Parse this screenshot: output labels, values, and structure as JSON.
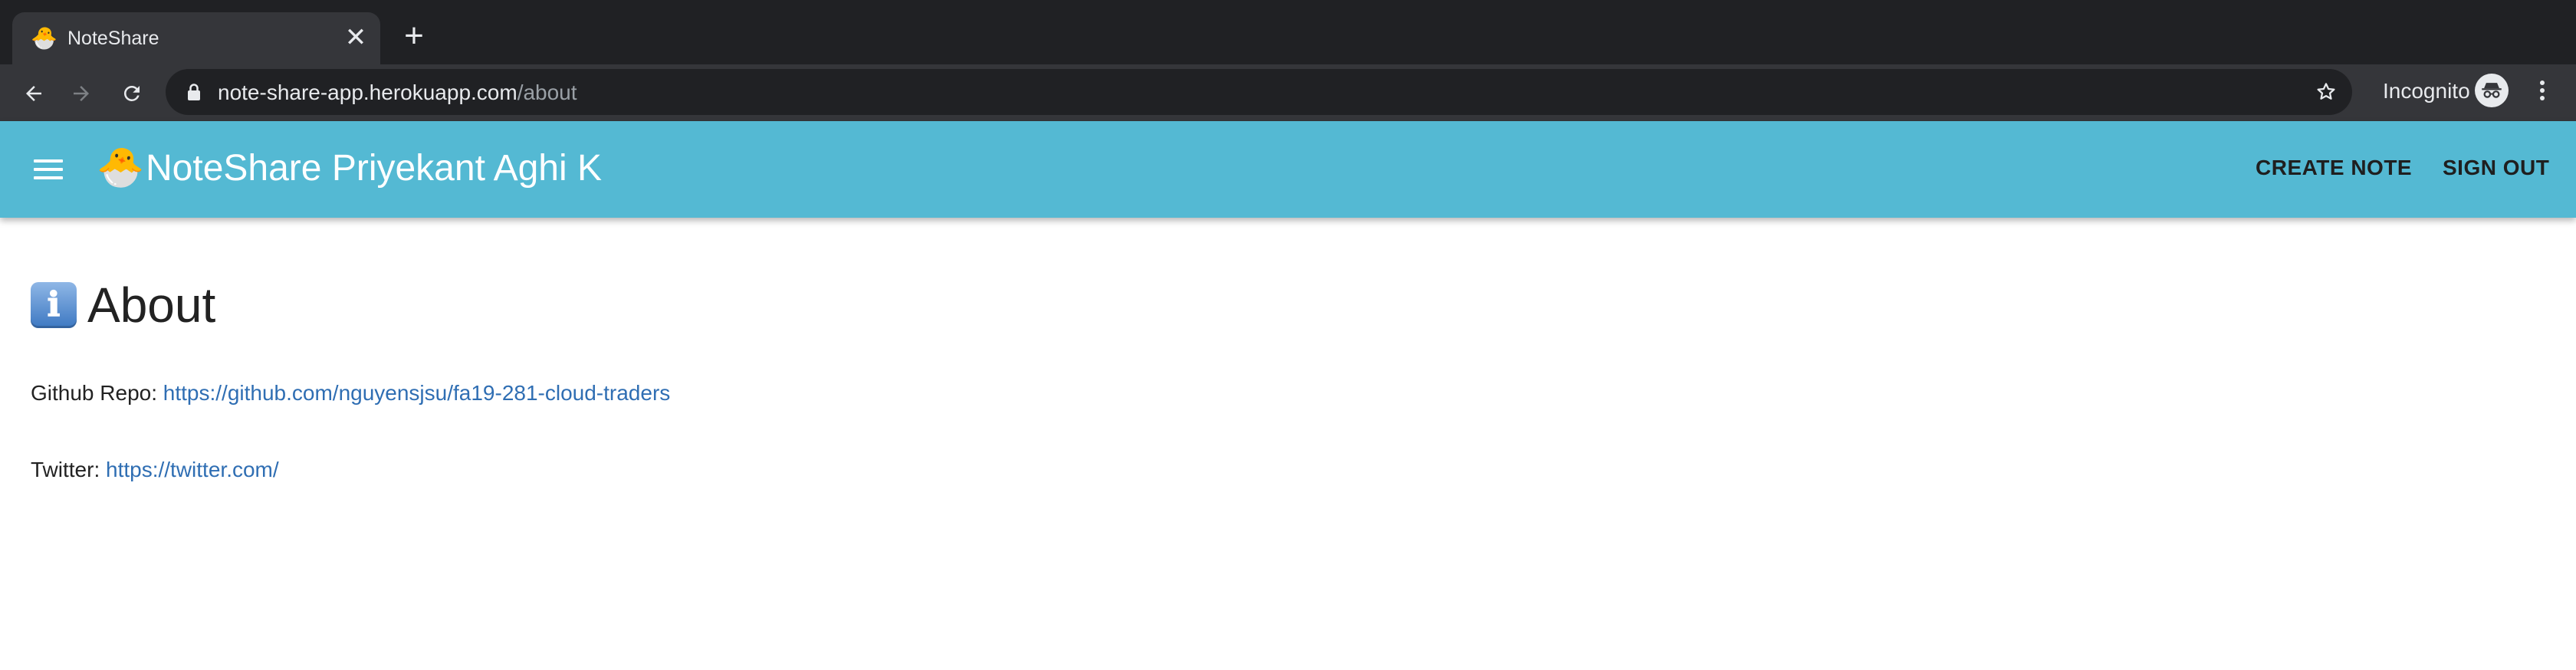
{
  "browser": {
    "tab": {
      "favicon": "🐣",
      "title": "NoteShare",
      "close_symbol": "✕"
    },
    "new_tab_symbol": "+",
    "address_bar": {
      "host": "note-share-app.herokuapp.com",
      "path": "/about"
    },
    "incognito_label": "Incognito",
    "icons": [
      "back-arrow-icon",
      "forward-arrow-icon",
      "reload-icon",
      "lock-icon",
      "star-icon",
      "incognito-icon",
      "more-vert-icon"
    ]
  },
  "appbar": {
    "logo": "🐣",
    "title": "NoteShare Priyekant Aghi K",
    "actions": [
      "CREATE NOTE",
      "SIGN OUT"
    ],
    "color": "#54b9d3"
  },
  "content": {
    "icon": "ℹ",
    "heading": "About",
    "github_label": "Github Repo:",
    "github_url": "https://github.com/nguyensjsu/fa19-281-cloud-traders",
    "twitter_label": "Twitter:",
    "twitter_url": "https://twitter.com/",
    "link_color": "#2f6eb3"
  }
}
